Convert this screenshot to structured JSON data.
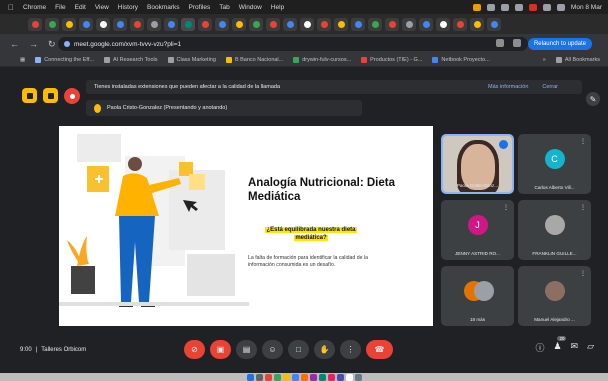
{
  "menubar": {
    "app": "Chrome",
    "items": [
      "Chrome",
      "File",
      "Edit",
      "View",
      "History",
      "Bookmarks",
      "Profiles",
      "Tab",
      "Window",
      "Help"
    ],
    "clock": "Mon 8 Mar"
  },
  "browser": {
    "url": "meet.google.com/xvm-tvvv-vzu?pli=1",
    "relaunch_label": "Relaunch to update",
    "bookmarks": [
      "Connecting the Eff...",
      "AI Research Tools",
      "Class Marketing",
      "B Banco Nacional...",
      "drywin-fulv-cursos...",
      "Productos (TIE) - G...",
      "Netbook Proyecto..."
    ],
    "bookmarks_right": [
      "All Bookmarks"
    ]
  },
  "meet": {
    "extension_notice": "Tienes instaladas extensiones que pueden afectar a la calidad de la llamada",
    "notice_links": [
      "Más información",
      "Cerrar"
    ],
    "presenting_text": "Paola Cristo-Gonzalez (Presentando y anotando)",
    "meeting_time": "9:00",
    "meeting_name": "Talleres Orbicom",
    "participant_count": "20"
  },
  "slide": {
    "title": "Analogía Nutricional: Dieta Mediática",
    "question": "¿Está equilibrada nuestra dieta mediática?",
    "body": "La falta de formación para identificar la calidad de la información consumida es un desafío."
  },
  "participants": [
    {
      "name": "Paola Cristo-Gonz...",
      "initial": "",
      "color": "#6b5a4b"
    },
    {
      "name": "Carlos Alberto Vill...",
      "initial": "C",
      "color": "#12b5cb"
    },
    {
      "name": "JENNY ASTRID RO...",
      "initial": "J",
      "color": "#d01884"
    },
    {
      "name": "FRANKLIN GUILLE...",
      "initial": "",
      "color": "#5f6368"
    },
    {
      "name": "18 más",
      "initial": "",
      "color": "#e37400"
    },
    {
      "name": "Manuel Alejandro ...",
      "initial": "",
      "color": "#5f6368"
    }
  ],
  "colors": {
    "meet_bg": "#202124",
    "tile_bg": "#3c4043",
    "accent": "#1a73e8",
    "highlight": "#ffe600",
    "end_call": "#ea4335"
  }
}
